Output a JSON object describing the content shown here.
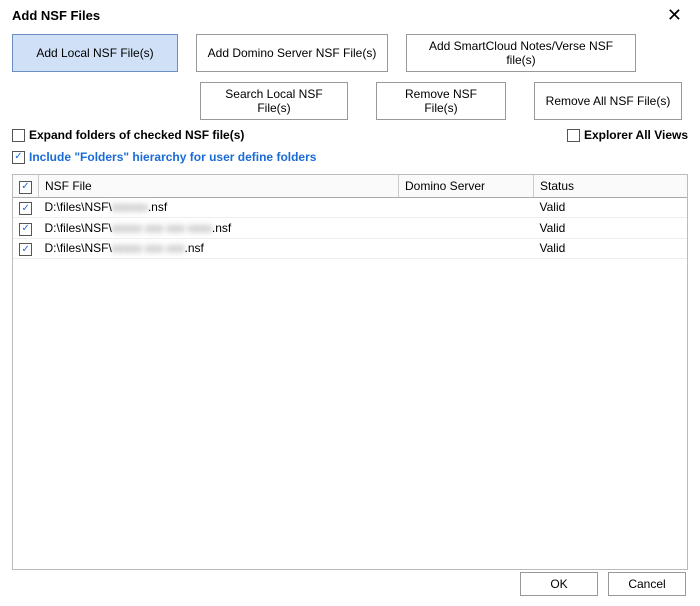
{
  "window": {
    "title": "Add NSF Files"
  },
  "buttons": {
    "add_local": "Add Local NSF File(s)",
    "add_domino": "Add Domino Server NSF File(s)",
    "add_smartcloud": "Add SmartCloud Notes/Verse NSF file(s)",
    "search_local": "Search Local NSF File(s)",
    "remove": "Remove NSF File(s)",
    "remove_all": "Remove All NSF File(s)",
    "ok": "OK",
    "cancel": "Cancel"
  },
  "checkboxes": {
    "expand_folders": {
      "label": "Expand folders of checked NSF file(s)",
      "checked": false
    },
    "explorer_all": {
      "label": "Explorer All Views",
      "checked": false
    },
    "include_folders": {
      "label": "Include \"Folders\" hierarchy for user define folders",
      "checked": true
    }
  },
  "table": {
    "headers": {
      "file": "NSF File",
      "server": "Domino Server",
      "status": "Status"
    },
    "header_checked": true,
    "rows": [
      {
        "checked": true,
        "file_prefix": "D:\\files\\NSF\\",
        "file_blur": "xxxxxx",
        "file_ext": ".nsf",
        "server": "",
        "status": "Valid"
      },
      {
        "checked": true,
        "file_prefix": "D:\\files\\NSF\\",
        "file_blur": "xxxxx xxx xxx xxxx",
        "file_ext": ".nsf",
        "server": "",
        "status": "Valid"
      },
      {
        "checked": true,
        "file_prefix": "D:\\files\\NSF\\",
        "file_blur": "xxxxx xxx xxx",
        "file_ext": ".nsf",
        "server": "",
        "status": "Valid"
      }
    ]
  }
}
